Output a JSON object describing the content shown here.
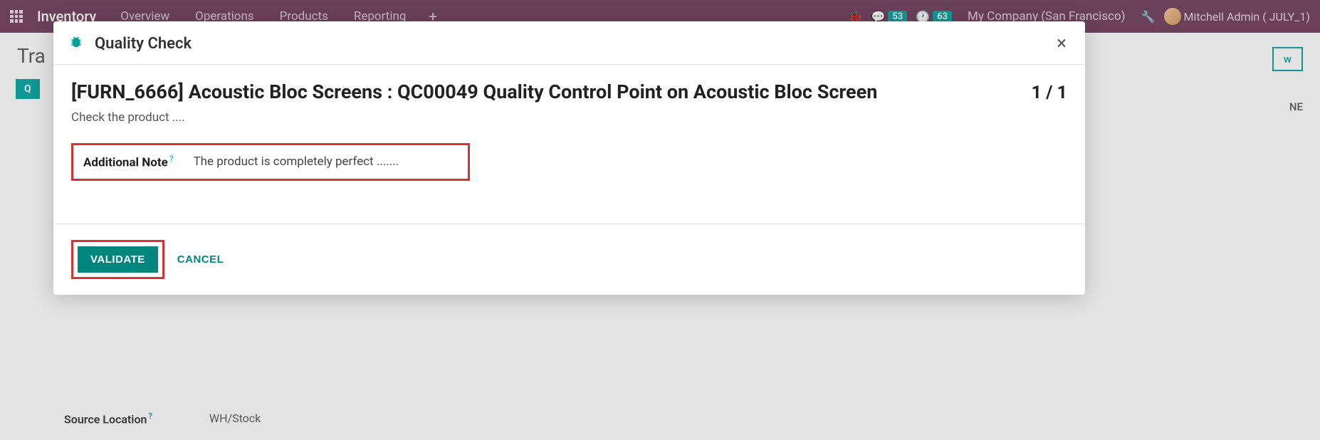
{
  "navbar": {
    "brand": "Inventory",
    "items": [
      "Overview",
      "Operations",
      "Products",
      "Reporting"
    ],
    "messages_count": "53",
    "activities_count": "63",
    "company": "My Company (San Francisco)",
    "user": "Mitchell Admin ( JULY_1)"
  },
  "background": {
    "title_partial": "Tra",
    "qc_partial": "Q",
    "new_partial": "w",
    "ne_partial": "NE",
    "source_location_label": "Source Location",
    "source_location_value": "WH/Stock"
  },
  "modal": {
    "title": "Quality Check",
    "headline": "[FURN_6666] Acoustic Bloc Screens : QC00049  Quality Control Point on Acoustic Bloc Screen",
    "pager": "1 / 1",
    "subtitle": "Check the product ....",
    "note_label": "Additional Note",
    "note_value": "The product is completely perfect .......",
    "validate": "VALIDATE",
    "cancel": "CANCEL"
  }
}
